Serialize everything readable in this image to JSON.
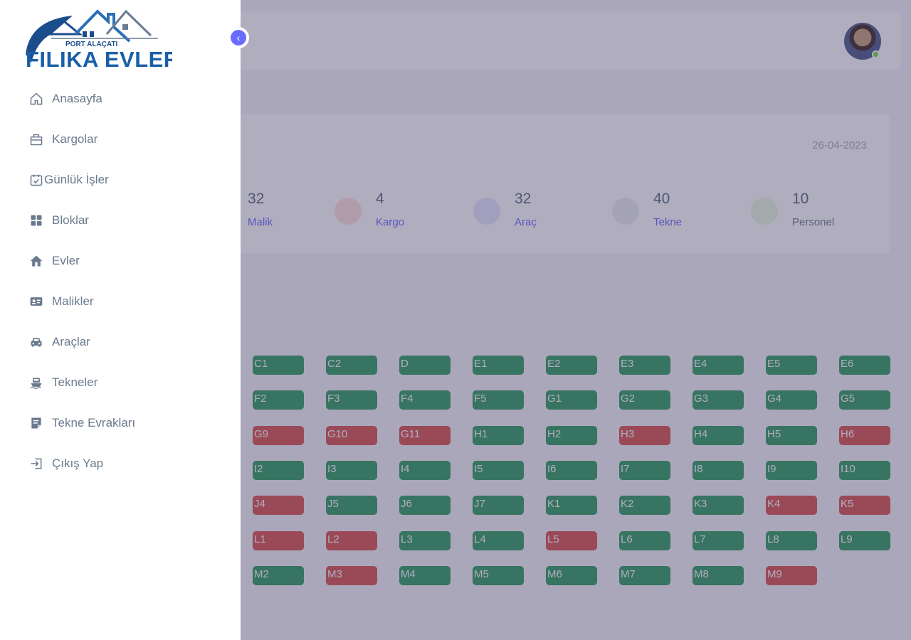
{
  "brand": {
    "logo_small": "PORT ALAÇATI",
    "logo_main": "FILIKA EVLERI"
  },
  "sidebar": {
    "items": [
      {
        "label": "Anasayfa",
        "icon": "home-icon"
      },
      {
        "label": "Kargolar",
        "icon": "cargo-icon"
      },
      {
        "label": "Günlük İşler",
        "icon": "calendar-check-icon"
      },
      {
        "label": "Bloklar",
        "icon": "grid-icon"
      },
      {
        "label": "Evler",
        "icon": "house-icon"
      },
      {
        "label": "Malikler",
        "icon": "id-card-icon"
      },
      {
        "label": "Araçlar",
        "icon": "car-icon"
      },
      {
        "label": "Tekneler",
        "icon": "boat-icon"
      },
      {
        "label": "Tekne Evrakları",
        "icon": "document-icon"
      },
      {
        "label": "Çıkış Yap",
        "icon": "logout-icon"
      }
    ]
  },
  "dashboard": {
    "date": "26-04-2023",
    "stats": [
      {
        "value": "32",
        "label": "Malik",
        "color": "#696cff"
      },
      {
        "value": "4",
        "label": "Kargo",
        "color": "#ff3e1d"
      },
      {
        "value": "32",
        "label": "Araç",
        "color": "#696cff"
      },
      {
        "value": "40",
        "label": "Tekne",
        "color": "#8592a3"
      },
      {
        "value": "10",
        "label": "Personel",
        "color": "#71dd37"
      }
    ],
    "units": [
      [
        {
          "name": "C1",
          "status": "green"
        },
        {
          "name": "C2",
          "status": "green"
        },
        {
          "name": "D",
          "status": "green"
        },
        {
          "name": "E1",
          "status": "green"
        },
        {
          "name": "E2",
          "status": "green"
        },
        {
          "name": "E3",
          "status": "green"
        },
        {
          "name": "E4",
          "status": "green"
        },
        {
          "name": "E5",
          "status": "green"
        },
        {
          "name": "E6",
          "status": "green"
        }
      ],
      [
        {
          "name": "F2",
          "status": "green"
        },
        {
          "name": "F3",
          "status": "green"
        },
        {
          "name": "F4",
          "status": "green"
        },
        {
          "name": "F5",
          "status": "green"
        },
        {
          "name": "G1",
          "status": "green"
        },
        {
          "name": "G2",
          "status": "green"
        },
        {
          "name": "G3",
          "status": "green"
        },
        {
          "name": "G4",
          "status": "green"
        },
        {
          "name": "G5",
          "status": "green"
        }
      ],
      [
        {
          "name": "G9",
          "status": "red"
        },
        {
          "name": "G10",
          "status": "red"
        },
        {
          "name": "G11",
          "status": "red"
        },
        {
          "name": "H1",
          "status": "green"
        },
        {
          "name": "H2",
          "status": "green"
        },
        {
          "name": "H3",
          "status": "red"
        },
        {
          "name": "H4",
          "status": "green"
        },
        {
          "name": "H5",
          "status": "green"
        },
        {
          "name": "H6",
          "status": "red"
        }
      ],
      [
        {
          "name": "I2",
          "status": "green"
        },
        {
          "name": "I3",
          "status": "green"
        },
        {
          "name": "I4",
          "status": "green"
        },
        {
          "name": "I5",
          "status": "green"
        },
        {
          "name": "I6",
          "status": "green"
        },
        {
          "name": "I7",
          "status": "green"
        },
        {
          "name": "I8",
          "status": "green"
        },
        {
          "name": "I9",
          "status": "green"
        },
        {
          "name": "I10",
          "status": "green"
        }
      ],
      [
        {
          "name": "J4",
          "status": "red"
        },
        {
          "name": "J5",
          "status": "green"
        },
        {
          "name": "J6",
          "status": "green"
        },
        {
          "name": "J7",
          "status": "green"
        },
        {
          "name": "K1",
          "status": "green"
        },
        {
          "name": "K2",
          "status": "green"
        },
        {
          "name": "K3",
          "status": "green"
        },
        {
          "name": "K4",
          "status": "red"
        },
        {
          "name": "K5",
          "status": "red"
        }
      ],
      [
        {
          "name": "L1",
          "status": "red"
        },
        {
          "name": "L2",
          "status": "red"
        },
        {
          "name": "L3",
          "status": "green"
        },
        {
          "name": "L4",
          "status": "green"
        },
        {
          "name": "L5",
          "status": "red"
        },
        {
          "name": "L6",
          "status": "green"
        },
        {
          "name": "L7",
          "status": "green"
        },
        {
          "name": "L8",
          "status": "green"
        },
        {
          "name": "L9",
          "status": "green"
        }
      ],
      [
        {
          "name": "M2",
          "status": "green"
        },
        {
          "name": "M3",
          "status": "red"
        },
        {
          "name": "M4",
          "status": "green"
        },
        {
          "name": "M5",
          "status": "green"
        },
        {
          "name": "M6",
          "status": "green"
        },
        {
          "name": "M7",
          "status": "green"
        },
        {
          "name": "M8",
          "status": "green"
        },
        {
          "name": "M9",
          "status": "red"
        }
      ]
    ]
  },
  "colors": {
    "accent": "#696cff",
    "available": "#2f9e5f",
    "occupied": "#d9534f",
    "overlay": "#433b63"
  }
}
